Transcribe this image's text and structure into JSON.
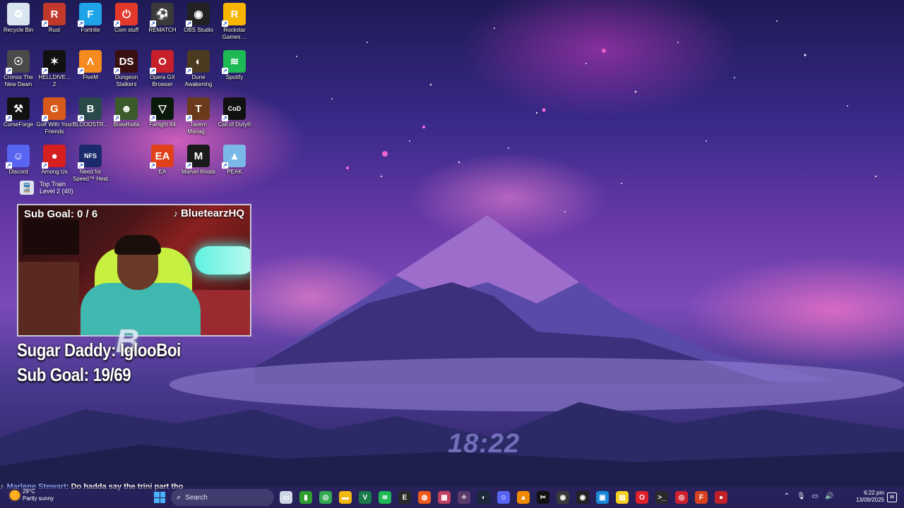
{
  "desktop_icons": [
    {
      "label": "Recycle Bin",
      "icon": "recycle-bin-icon",
      "color": "#d9e6f2",
      "glyph": "♻"
    },
    {
      "label": "Rust",
      "icon": "rust-icon",
      "color": "#c0392b",
      "glyph": "R"
    },
    {
      "label": "Fortnite",
      "icon": "fortnite-icon",
      "color": "#1fa3e8",
      "glyph": "F"
    },
    {
      "label": "Com stuff",
      "icon": "power-icon",
      "color": "#e23a2a",
      "glyph": "⏻"
    },
    {
      "label": "REMATCH",
      "icon": "soccer-ball-icon",
      "color": "#3a3a3a",
      "glyph": "⚽"
    },
    {
      "label": "OBS Studio",
      "icon": "obs-icon",
      "color": "#222222",
      "glyph": "◉"
    },
    {
      "label": "Rockstar Games ...",
      "icon": "rockstar-icon",
      "color": "#f7b500",
      "glyph": "R"
    },
    {
      "label": "Cronos The New Dawn",
      "icon": "cronos-icon",
      "color": "#4a4a4a",
      "glyph": "☉"
    },
    {
      "label": "HELLDIVE... 2",
      "icon": "helldivers-icon",
      "color": "#111111",
      "glyph": "✶"
    },
    {
      "label": "FiveM",
      "icon": "fivem-icon",
      "color": "#f58a1f",
      "glyph": "Λ"
    },
    {
      "label": "Dungeon Stalkers",
      "icon": "dungeon-stalkers-icon",
      "color": "#3a0f0f",
      "glyph": "DS"
    },
    {
      "label": "Opera GX Browser",
      "icon": "opera-gx-icon",
      "color": "#c8202a",
      "glyph": "O"
    },
    {
      "label": "Dune Awakening",
      "icon": "dune-icon",
      "color": "#4a3a20",
      "glyph": "◐"
    },
    {
      "label": "Spotify",
      "icon": "spotify-icon",
      "color": "#1db954",
      "glyph": "≋"
    },
    {
      "label": "CurseForge",
      "icon": "curseforge-icon",
      "color": "#111111",
      "glyph": "⚒"
    },
    {
      "label": "Golf With Your Friends",
      "icon": "golf-icon",
      "color": "#d85a1a",
      "glyph": "G"
    },
    {
      "label": "BLOODSTR...",
      "icon": "bloodstrike-icon",
      "color": "#2a4a4a",
      "glyph": "B"
    },
    {
      "label": "Brawlhalla",
      "icon": "brawlhalla-icon",
      "color": "#3a5a2a",
      "glyph": "☻"
    },
    {
      "label": "Farlight 84",
      "icon": "farlight-icon",
      "color": "#0a1a0a",
      "glyph": "▽"
    },
    {
      "label": "Tavern Manag...",
      "icon": "tavern-icon",
      "color": "#6a3a1a",
      "glyph": "T"
    },
    {
      "label": "Call of Duty®",
      "icon": "call-of-duty-icon",
      "color": "#111111",
      "glyph": "CoD"
    },
    {
      "label": "Discord",
      "icon": "discord-icon",
      "color": "#5865f2",
      "glyph": "☺"
    },
    {
      "label": "Among Us",
      "icon": "among-us-icon",
      "color": "#d62020",
      "glyph": "●"
    },
    {
      "label": "Need for Speed™ Heat",
      "icon": "nfs-icon",
      "color": "#1a2a6a",
      "glyph": "NFS"
    },
    {
      "label": "EA",
      "icon": "ea-icon",
      "color": "#e0401a",
      "glyph": "EA"
    },
    {
      "label": "Marvel Rivals",
      "icon": "marvel-rivals-icon",
      "color": "#1a1a1a",
      "glyph": "M"
    },
    {
      "label": "PEAK",
      "icon": "peak-icon",
      "color": "#7ab8e8",
      "glyph": "▲"
    }
  ],
  "top_train": {
    "line1": "Top Train",
    "line2": "Level 2  (40)"
  },
  "webcam": {
    "sub_goal": "Sub Goal:  0 / 6",
    "handle": "BluetearzHQ",
    "note_glyph": "♪"
  },
  "overlay": {
    "line1": "Sugar Daddy: IglooBoi",
    "line2": "Sub Goal: 19/69",
    "logo_glyph": "B"
  },
  "desktop_clock": "18:22",
  "chat": {
    "platform_glyph": "♪",
    "name": "Marlene Stewart",
    "message": ": Do hadda say the trini part tho"
  },
  "taskbar": {
    "weather_temp": "29°C",
    "weather_desc": "Partly sunny",
    "search_label": "Search",
    "apps": [
      {
        "name": "task-view-icon",
        "color": "#cfd6e4",
        "glyph": "▭"
      },
      {
        "name": "xbox-app-icon",
        "color": "#2e9e2e",
        "glyph": "▮"
      },
      {
        "name": "chrome-icon",
        "color": "#34a853",
        "glyph": "◎"
      },
      {
        "name": "file-explorer-icon",
        "color": "#f2b90f",
        "glyph": "▬"
      },
      {
        "name": "vim-icon",
        "color": "#1a7a4a",
        "glyph": "V"
      },
      {
        "name": "spotify-taskbar-icon",
        "color": "#1db954",
        "glyph": "≋"
      },
      {
        "name": "epic-games-icon",
        "color": "#2a2a2a",
        "glyph": "E"
      },
      {
        "name": "origin-icon",
        "color": "#f05a1a",
        "glyph": "◍"
      },
      {
        "name": "app-icon",
        "color": "#c04060",
        "glyph": "▦"
      },
      {
        "name": "game-icon",
        "color": "#5a3a6a",
        "glyph": "✧"
      },
      {
        "name": "steam-icon",
        "color": "#1b2838",
        "glyph": "◐"
      },
      {
        "name": "discord-taskbar-icon",
        "color": "#5865f2",
        "glyph": "☺"
      },
      {
        "name": "vlc-icon",
        "color": "#f08a00",
        "glyph": "▲"
      },
      {
        "name": "capcut-icon",
        "color": "#111111",
        "glyph": "✂"
      },
      {
        "name": "camera-icon",
        "color": "#3a3a3a",
        "glyph": "◉"
      },
      {
        "name": "obs-taskbar-icon",
        "color": "#222222",
        "glyph": "◉"
      },
      {
        "name": "photos-icon",
        "color": "#1a8ad8",
        "glyph": "▣"
      },
      {
        "name": "sticky-notes-icon",
        "color": "#f5d020",
        "glyph": "▤"
      },
      {
        "name": "opera-taskbar-icon",
        "color": "#e0202a",
        "glyph": "O"
      },
      {
        "name": "terminal-icon",
        "color": "#2a2a2a",
        "glyph": ">_"
      },
      {
        "name": "game-bar-icon",
        "color": "#d02030",
        "glyph": "◎"
      },
      {
        "name": "faceit-icon",
        "color": "#d84020",
        "glyph": "F"
      },
      {
        "name": "record-icon",
        "color": "#c02028",
        "glyph": "●"
      }
    ],
    "time": "6:22 pm",
    "date": "13/09/2025"
  }
}
